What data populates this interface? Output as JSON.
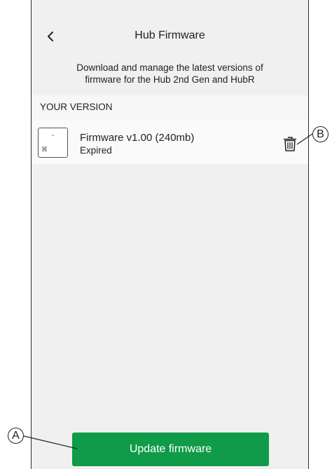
{
  "header": {
    "title": "Hub Firmware",
    "subtitle": "Download and manage the latest versions of firmware for the Hub 2nd Gen and HubR"
  },
  "section": {
    "label": "YOUR VERSION"
  },
  "firmware": {
    "thumb_dash": "-",
    "thumb_qr": "⌘",
    "name": "Firmware v1.00 (240mb)",
    "status": "Expired"
  },
  "footer": {
    "update_label": "Update firmware"
  },
  "callouts": {
    "a": "A",
    "b": "B"
  },
  "icons": {
    "back": "chevron-left-icon",
    "delete": "trash-icon"
  },
  "colors": {
    "primary_button": "#0f9b47",
    "background": "#f0f0f0"
  }
}
